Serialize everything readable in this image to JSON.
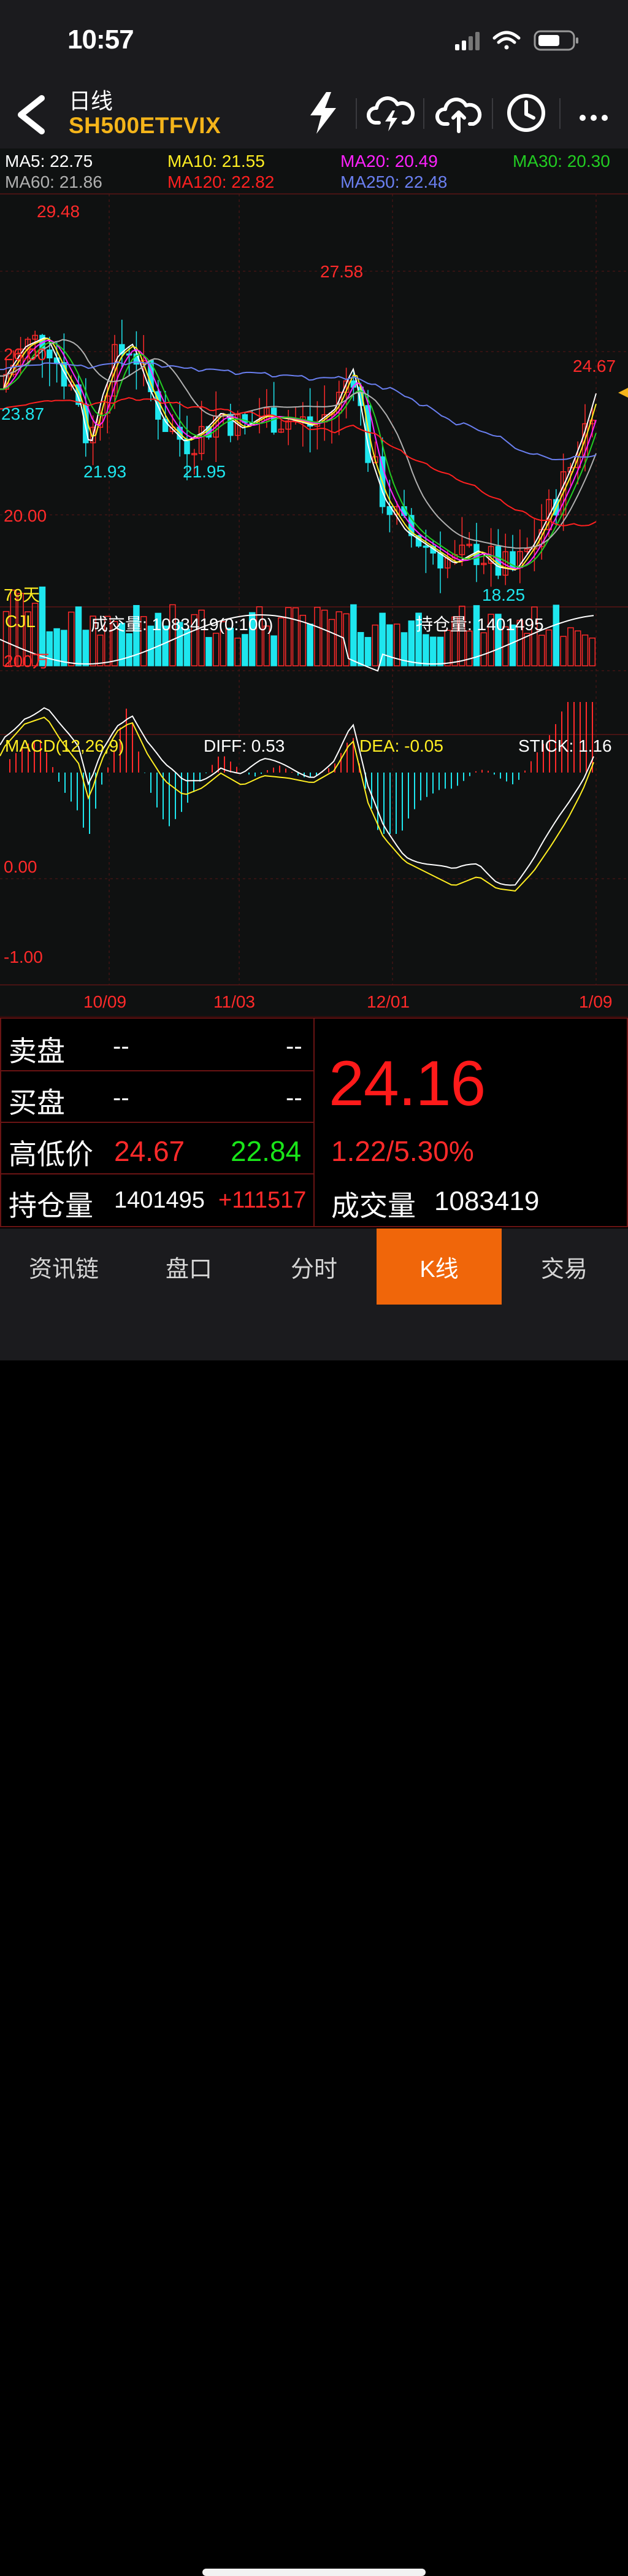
{
  "status_bar": {
    "time": "10:57"
  },
  "header": {
    "title": "日线",
    "symbol": "SH500ETFVIX"
  },
  "colors": {
    "up": "#ff2a2a",
    "down": "#1ee6ee",
    "ma5": "#ffffff",
    "ma10": "#ffee22",
    "ma20": "#ff22ff",
    "ma30": "#22cc22",
    "ma60": "#b0b0b0",
    "ma120": "#ff2020",
    "ma250": "#6a7ff0",
    "accent": "#f0660a",
    "symbol": "#f4b41a"
  },
  "ma_legend": [
    {
      "label": "MA5: 22.75",
      "color": "#ffffff"
    },
    {
      "label": "MA10: 21.55",
      "color": "#ffee22"
    },
    {
      "label": "MA20: 20.49",
      "color": "#ff22ff"
    },
    {
      "label": "MA30: 20.30",
      "color": "#22cc22"
    },
    {
      "label": "MA60: 21.86",
      "color": "#b0b0b0"
    },
    {
      "label": "MA120: 22.82",
      "color": "#ff2020"
    },
    {
      "label": "MA250: 22.48",
      "color": "#6a7ff0"
    }
  ],
  "chart_data": {
    "type": "candlestick",
    "price_axis_labels": [
      "26.00",
      "23.87",
      "20.00"
    ],
    "period_label": "79天",
    "annotations": [
      {
        "text": "29.48",
        "value": 29.48,
        "type": "high"
      },
      {
        "text": "21.93",
        "value": 21.93,
        "type": "low"
      },
      {
        "text": "21.95",
        "value": 21.95,
        "type": "low"
      },
      {
        "text": "27.58",
        "value": 27.58,
        "type": "high"
      },
      {
        "text": "18.25",
        "value": 18.25,
        "type": "low"
      },
      {
        "text": "24.67",
        "value": 24.67,
        "type": "high"
      }
    ],
    "x_ticks": [
      "10/09",
      "11/03",
      "12/01",
      "1/09"
    ],
    "volume_header": {
      "name": "CJL",
      "volume": "成交量: 1083419(0:100)",
      "open_interest": "持仓量: 1401495",
      "axis_label": "200万"
    },
    "macd_header": {
      "name": "MACD(12,26,9)",
      "diff": "DIFF: 0.53",
      "dea": "DEA: -0.05",
      "stick": "STICK: 1.16"
    },
    "macd_axis_labels": [
      "0.00",
      "-1.00"
    ]
  },
  "quote": {
    "sell_label": "卖盘",
    "sell_price": "--",
    "sell_qty": "--",
    "buy_label": "买盘",
    "buy_price": "--",
    "buy_qty": "--",
    "highlow_label": "高低价",
    "high": "24.67",
    "low": "22.84",
    "oi_label": "持仓量",
    "oi": "1401495",
    "oi_change": "+111517",
    "last_price": "24.16",
    "change": "1.22/5.30%",
    "volume_label": "成交量",
    "volume": "1083419"
  },
  "tabs": [
    "资讯链",
    "盘口",
    "分时",
    "K线",
    "交易"
  ],
  "active_tab": 3
}
